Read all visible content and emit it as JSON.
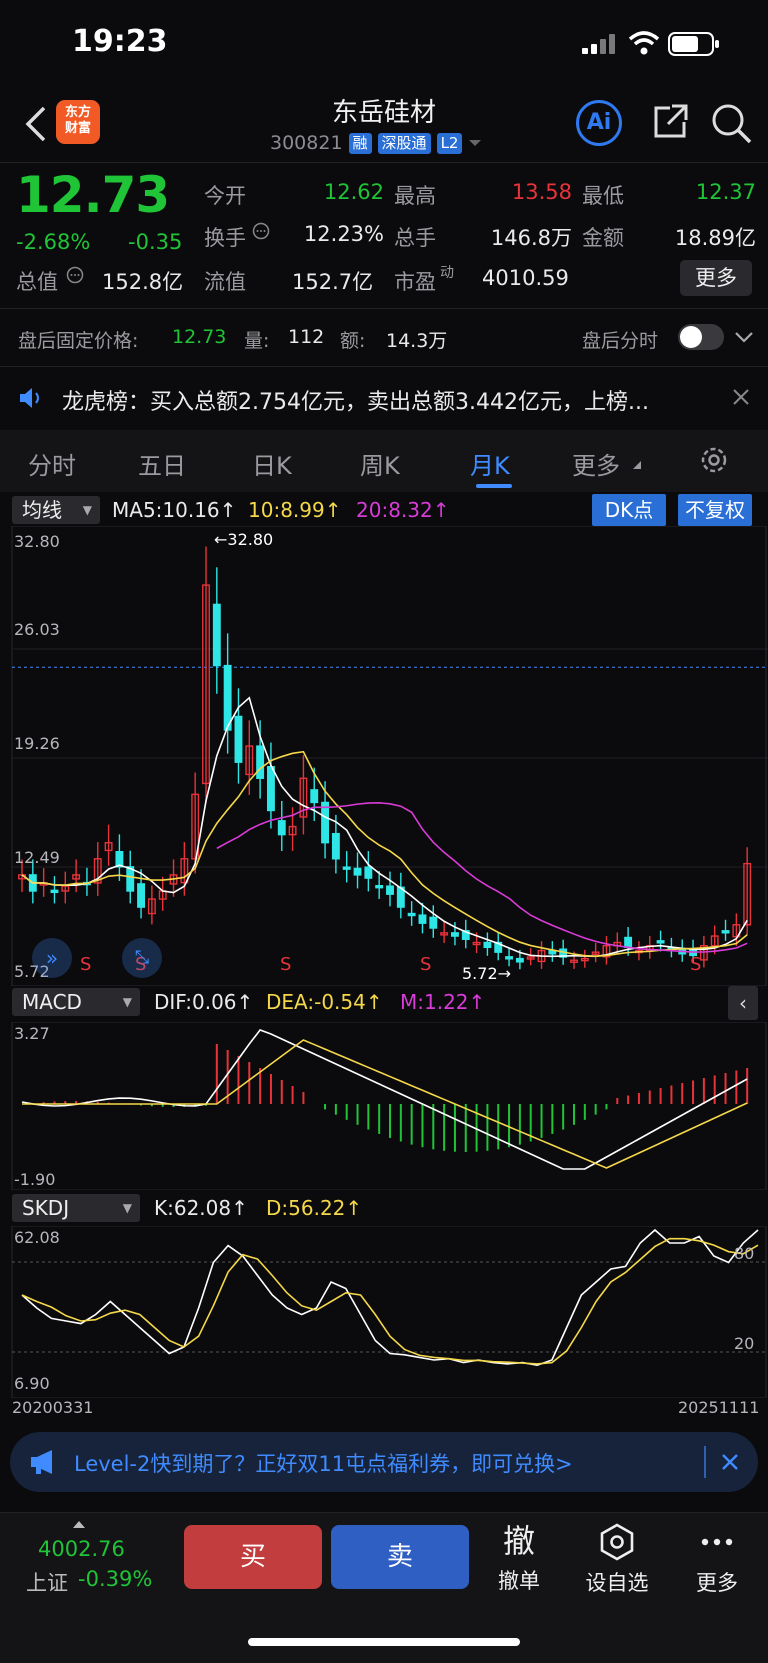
{
  "status": {
    "time": "19:23"
  },
  "header": {
    "logo_line1": "东方",
    "logo_line2": "财富",
    "name": "东岳硅材",
    "code": "300821",
    "tags": [
      "融",
      "深股通",
      "L2"
    ],
    "ai_label": "Ai"
  },
  "quote": {
    "price": "12.73",
    "change_pct": "-2.68%",
    "change": "-0.35",
    "rows": [
      [
        {
          "l": "今开",
          "v": "12.62",
          "c": "green"
        },
        {
          "l": "最高",
          "v": "13.58",
          "c": "red"
        },
        {
          "l": "最低",
          "v": "12.37",
          "c": "green"
        }
      ],
      [
        {
          "l": "换手",
          "v": "12.23%",
          "c": "white"
        },
        {
          "l": "总手",
          "v": "146.8万",
          "c": "white"
        },
        {
          "l": "金额",
          "v": "18.89亿",
          "c": "white"
        }
      ]
    ],
    "total_value_label": "总值",
    "total_value": "152.8亿",
    "float_label": "流值",
    "float_value": "152.7亿",
    "pe_label": "市盈",
    "pe_sup": "动",
    "pe_value": "4010.59",
    "more": "更多"
  },
  "after_hours": {
    "label": "盘后固定价格:",
    "price": "12.73",
    "vol_label": "量:",
    "vol": "112",
    "amt_label": "额:",
    "amt": "14.3万",
    "toggle_label": "盘后分时"
  },
  "news": {
    "text": "龙虎榜：买入总额2.754亿元，卖出总额3.442亿元，上榜..."
  },
  "tabs": [
    {
      "label": "分时"
    },
    {
      "label": "五日"
    },
    {
      "label": "日K"
    },
    {
      "label": "周K"
    },
    {
      "label": "月K",
      "active": true
    },
    {
      "label": "更多"
    }
  ],
  "kline": {
    "indicator": "均线",
    "ma5": "MA5:10.16↑",
    "ma10": "10:8.99↑",
    "ma20": "20:8.32↑",
    "dk_label": "DK点",
    "fq_label": "不复权",
    "axis": [
      "32.80",
      "26.03",
      "19.26",
      "12.49",
      "5.72"
    ],
    "high_mark": "←32.80",
    "low_mark": "5.72→",
    "colors": {
      "up": "#e8333a",
      "down": "#2ee6e6",
      "ma5": "#ffffff",
      "ma10": "#f5d84a",
      "ma20": "#d93bd9"
    }
  },
  "macd": {
    "indicator": "MACD",
    "dif": "DIF:0.06↑",
    "dea": "DEA:-0.54↑",
    "m": "M:1.22↑",
    "axis_top": "3.27",
    "axis_bottom": "-1.90"
  },
  "kdj": {
    "indicator": "SKDJ",
    "k": "K:62.08↑",
    "d": "D:56.22↑",
    "axis_top": "62.08",
    "axis_bottom": "6.90",
    "level_80": "80",
    "level_20": "20",
    "date_start": "20200331",
    "date_end": "20251111"
  },
  "banner": {
    "text": "Level-2快到期了？正好双11屯点福利券，即可兑换>"
  },
  "bottom": {
    "index_value": "4002.76",
    "index_name": "上证",
    "index_change": "-0.39%",
    "buy": "买",
    "sell": "卖",
    "cancel_icon": "撤",
    "cancel": "撤单",
    "watch": "设自选",
    "more": "更多"
  }
}
